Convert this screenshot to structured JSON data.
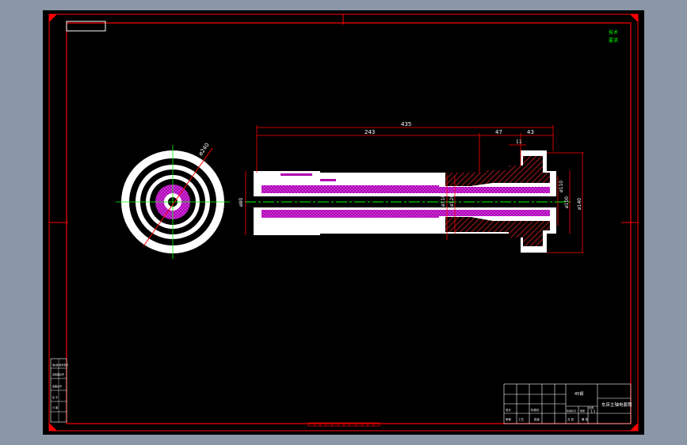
{
  "app": {
    "background": "#8b96a7",
    "canvas_background": "#000000",
    "colors": {
      "frame": "#ff0000",
      "part": "#ffffff",
      "magenta_fill": "#b000b0",
      "hatch": "#8a1010",
      "center_line": "#00ff00",
      "dimension": "#ff0000"
    }
  },
  "corner_note": {
    "lines": [
      "技术",
      "要求"
    ]
  },
  "dimensions": {
    "overall_length": "435",
    "main_length": "243",
    "step_length": "47",
    "flange_length": "43",
    "flange_width": "11",
    "dia_left": "ø80",
    "dia_inner_1": "ø110",
    "dia_inner_2": "ø128",
    "dia_right_1": "ø110",
    "dia_right_2": "ø100",
    "dia_right_3": "ø140",
    "circle_dia": "ø240"
  },
  "title_block": {
    "drawing_name": "车床主轴电套筒",
    "material": "45钢",
    "labels": [
      "设计",
      "标准化",
      "审核",
      "工艺",
      "批准",
      "阶段标记",
      "重量",
      "比例",
      "共 张",
      "第 张"
    ],
    "scale": "1:1"
  },
  "side_table": {
    "labels": [
      "借(通)用件登记",
      "旧底图总号",
      "底图总号",
      "签 字",
      "日 期"
    ]
  },
  "bottom_ruler": {
    "marks": 12
  }
}
